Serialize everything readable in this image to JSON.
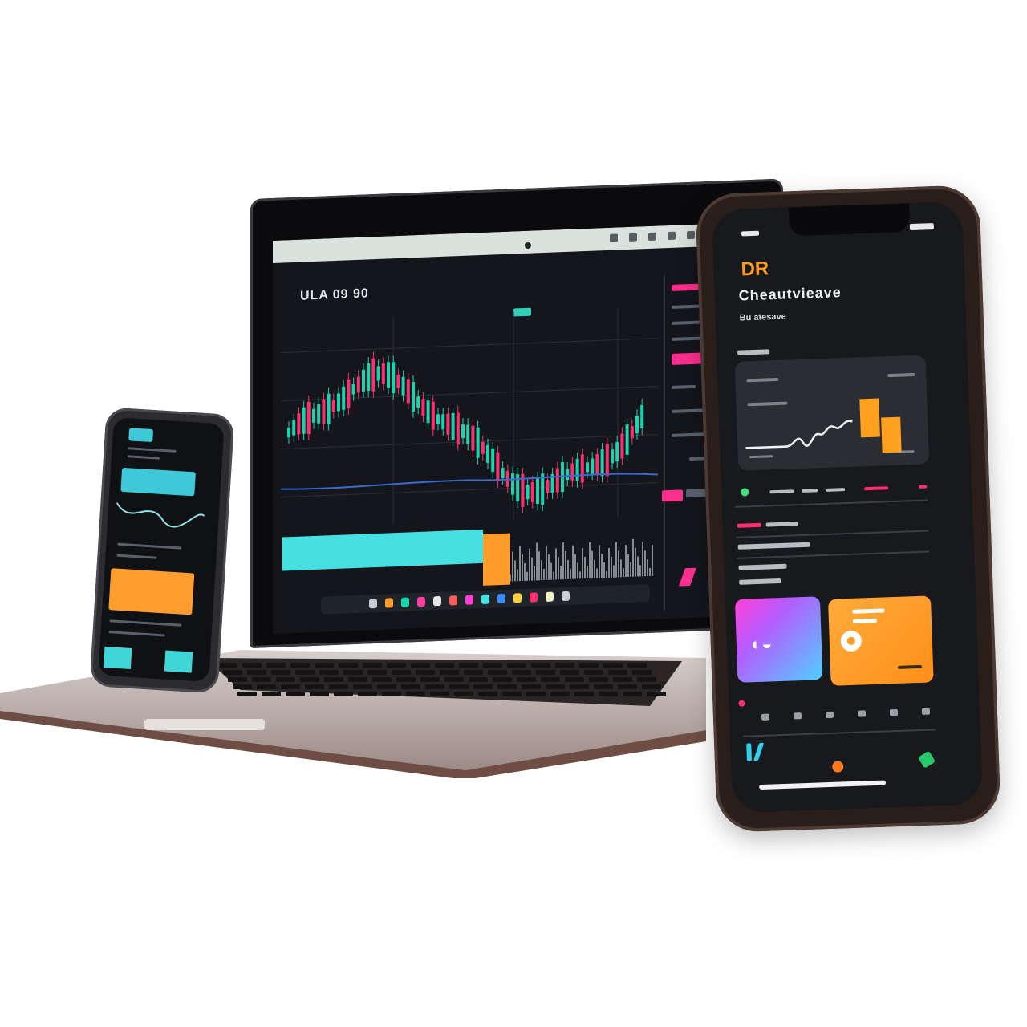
{
  "scene": {
    "background": "#ffffff",
    "devices": [
      "laptop",
      "small-phone",
      "large-phone"
    ]
  },
  "laptop": {
    "ticker": "ULA 09 90",
    "accent_colors": {
      "up": "#19d4b0",
      "down": "#ff2f6e",
      "volume": "#46e0e3",
      "highlight": "#ff9b29"
    }
  },
  "large_phone": {
    "logo": "DR",
    "title": "Cheautvieave",
    "subtitle": "Bu atesave",
    "colors": {
      "accent": "#ffa01e",
      "magenta": "#ff3fd6",
      "screen": "#17191d"
    }
  }
}
